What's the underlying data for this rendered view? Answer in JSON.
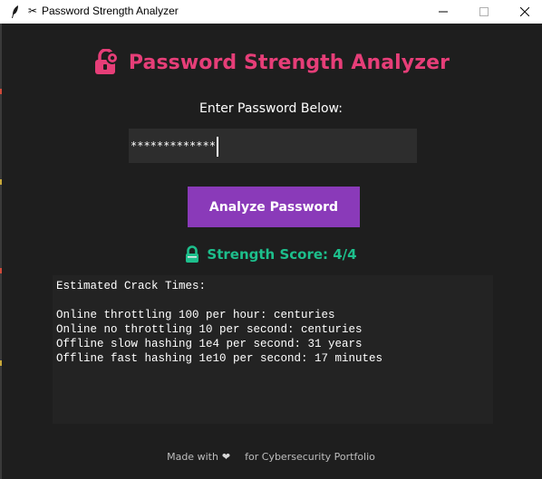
{
  "window": {
    "title": "Password Strength Analyzer",
    "controls": {
      "minimize_icon": "minimize-icon",
      "maximize_icon": "maximize-icon",
      "close_icon": "close-icon"
    }
  },
  "header": {
    "title": "Password Strength Analyzer",
    "icon": "lock-icon",
    "color": "#e63e78"
  },
  "form": {
    "prompt": "Enter Password Below:",
    "password_masked": "*************",
    "analyze_label": "Analyze Password",
    "button_color": "#8a3ab9"
  },
  "result": {
    "score_text": "Strength Score: 4/4",
    "score_icon": "green-lock-icon",
    "score_color": "#1dbf8c",
    "crack_times_lines": [
      "Estimated Crack Times:",
      "",
      "Online throttling 100 per hour: centuries",
      "Online no throttling 10 per second: centuries",
      "Offline slow hashing 1e4 per second: 31 years",
      "Offline fast hashing 1e10 per second: 17 minutes"
    ]
  },
  "footer": {
    "made_with": "Made with",
    "heart": "❤",
    "suffix": "for Cybersecurity Portfolio"
  }
}
